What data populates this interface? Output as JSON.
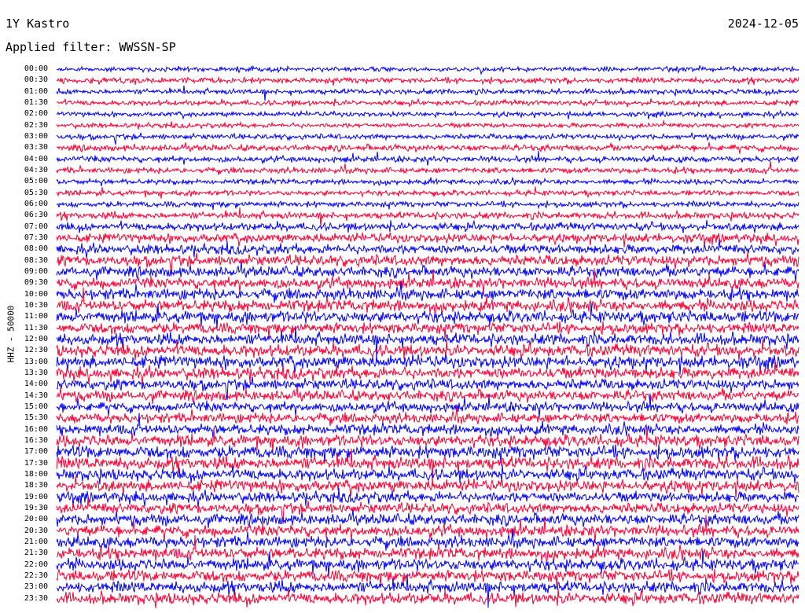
{
  "header": {
    "station": "1Y Kastro",
    "date": "2024-12-05",
    "filter": "Applied filter: WWSSN-SP"
  },
  "chart_data": {
    "type": "line",
    "title": "1Y Kastro",
    "ylabel": "HHZ - 50000",
    "row_labels": [
      "00:00",
      "00:30",
      "01:00",
      "01:30",
      "02:00",
      "02:30",
      "03:00",
      "03:30",
      "04:00",
      "04:30",
      "05:00",
      "05:30",
      "06:00",
      "06:30",
      "07:00",
      "07:30",
      "08:00",
      "08:30",
      "09:00",
      "09:30",
      "10:00",
      "10:30",
      "11:00",
      "11:30",
      "12:00",
      "12:30",
      "13:00",
      "13:30",
      "14:00",
      "14:30",
      "15:00",
      "15:30",
      "16:00",
      "16:30",
      "17:00",
      "17:30",
      "18:00",
      "18:30",
      "19:00",
      "19:30",
      "20:00",
      "20:30",
      "21:00",
      "21:30",
      "22:00",
      "22:30",
      "23:00",
      "23:30"
    ],
    "row_colors": [
      "#0000ff",
      "#ff0033"
    ],
    "relative_amplitude": [
      0.45,
      0.55,
      0.5,
      0.5,
      0.45,
      0.45,
      0.5,
      0.6,
      0.55,
      0.55,
      0.5,
      0.5,
      0.55,
      0.65,
      0.75,
      0.85,
      0.9,
      1.0,
      1.0,
      1.0,
      1.05,
      1.1,
      1.1,
      1.05,
      1.1,
      1.15,
      1.15,
      1.1,
      1.0,
      1.0,
      0.9,
      0.95,
      1.0,
      1.1,
      1.2,
      1.2,
      1.1,
      1.1,
      1.0,
      1.0,
      1.05,
      1.05,
      1.05,
      1.1,
      1.1,
      1.1,
      1.1,
      1.1
    ]
  }
}
